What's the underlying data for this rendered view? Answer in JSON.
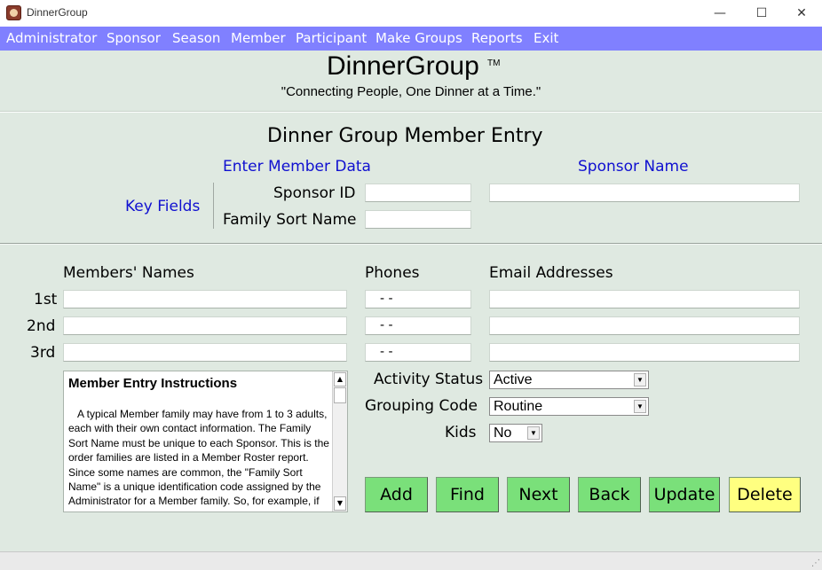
{
  "window": {
    "title": "DinnerGroup",
    "minimize_glyph": "—",
    "maximize_glyph": "☐",
    "close_glyph": "✕"
  },
  "menu": [
    "Administrator",
    "Sponsor",
    "Season",
    "Member",
    "Participant",
    "Make Groups",
    "Reports",
    "Exit"
  ],
  "brand": {
    "name": "DinnerGroup",
    "tm": "TM",
    "slogan": "\"Connecting People, One Dinner at a Time.\""
  },
  "form": {
    "title": "Dinner Group Member Entry",
    "enter_member_data": "Enter Member Data",
    "sponsor_name_label": "Sponsor Name",
    "key_fields_label": "Key Fields",
    "sponsor_id_label": "Sponsor ID",
    "family_sort_name_label": "Family Sort Name",
    "sponsor_id_value": "",
    "family_sort_name_value": "",
    "sponsor_name_value": ""
  },
  "members": {
    "names_header": "Members' Names",
    "phones_header": "Phones",
    "emails_header": "Email Addresses",
    "rows": [
      {
        "label": "1st",
        "name": "",
        "phone": " -  -",
        "email": ""
      },
      {
        "label": "2nd",
        "name": "",
        "phone": " -  -",
        "email": ""
      },
      {
        "label": "3rd",
        "name": "",
        "phone": " -  -",
        "email": ""
      }
    ]
  },
  "instructions": {
    "heading": "Member Entry Instructions",
    "body": "A typical Member family may have from 1 to 3 adults, each with their own contact information. The Family Sort Name must be unique to each Sponsor.  This is the order families are listed in a Member Roster report.  Since some names are common, the \"Family Sort Name\" is a unique identification code assigned by the Administrator for a Member family.  So, for example, if the"
  },
  "status": {
    "activity_label": "Activity Status",
    "activity_value": "Active",
    "grouping_label": "Grouping Code",
    "grouping_value": "Routine",
    "kids_label": "Kids",
    "kids_value": "No"
  },
  "buttons": {
    "add": "Add",
    "find": "Find",
    "next": "Next",
    "back": "Back",
    "update": "Update",
    "delete": "Delete"
  },
  "colors": {
    "menubar": "#8080ff",
    "background": "#dfe9e1",
    "button_green": "#7ae07a",
    "button_yellow": "#ffff80",
    "label_blue": "#1010d0"
  }
}
